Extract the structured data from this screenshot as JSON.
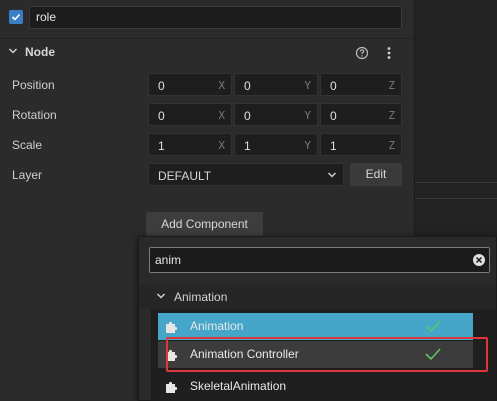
{
  "node_name": "role",
  "node_section": {
    "title": "Node"
  },
  "properties": {
    "position": {
      "label": "Position",
      "x": "0",
      "y": "0",
      "z": "0"
    },
    "rotation": {
      "label": "Rotation",
      "x": "0",
      "y": "0",
      "z": "0"
    },
    "scale": {
      "label": "Scale",
      "x": "1",
      "y": "1",
      "z": "1"
    },
    "layer": {
      "label": "Layer",
      "value": "DEFAULT",
      "edit_label": "Edit"
    }
  },
  "axis_labels": {
    "x": "X",
    "y": "Y",
    "z": "Z"
  },
  "add_component_label": "Add Component",
  "popup": {
    "search_value": "anim",
    "category": "Animation",
    "items": [
      {
        "label": "Animation",
        "state": "selected",
        "checked": true
      },
      {
        "label": "Animation Controller",
        "state": "hovered",
        "checked": true
      },
      {
        "label": "SkeletalAnimation",
        "state": "normal",
        "checked": false
      }
    ]
  },
  "colors": {
    "accent": "#3b7ec8",
    "selected_row": "#46a6c9",
    "check_green": "#5fc26a",
    "highlight_red": "#e0363e"
  }
}
